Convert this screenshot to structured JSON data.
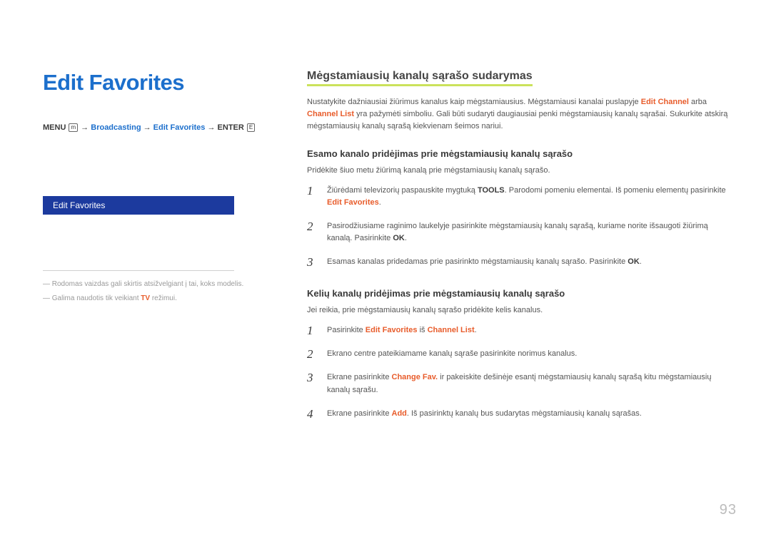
{
  "left": {
    "title": "Edit Favorites",
    "breadcrumb": {
      "menu": "MENU",
      "menu_icon": "m",
      "seg1": "Broadcasting",
      "seg2": "Edit Favorites",
      "enter": "ENTER",
      "enter_icon": "E"
    },
    "menu_item": "Edit Favorites",
    "footnote1_pre": " ― Rodomas vaizdas gali skirtis atsižvelgiant į tai, koks modelis.",
    "footnote2_pre": " ― Galima naudotis tik veikiant ",
    "footnote2_hl": "TV",
    "footnote2_post": " režimui."
  },
  "right": {
    "section_title": "Mėgstamiausių kanalų sąrašo sudarymas",
    "intro_pre": "Nustatykite dažniausiai žiūrimus kanalus kaip mėgstamiausius. Mėgstamiausi kanalai puslapyje ",
    "intro_hl1": "Edit Channel",
    "intro_mid": " arba ",
    "intro_hl2": "Channel List",
    "intro_post": " yra pažymėti simboliu. Gali būti sudaryti daugiausiai penki mėgstamiausių kanalų sąrašai. Sukurkite atskirą mėgstamiausių kanalų sąrašą kiekvienam šeimos nariui.",
    "sub1": {
      "heading": "Esamo kanalo pridėjimas prie mėgstamiausių kanalų sąrašo",
      "intro": "Pridėkite šiuo metu žiūrimą kanalą prie mėgstamiausių kanalų sąrašo.",
      "s1_pre": "Žiūrėdami televizorių paspauskite mygtuką ",
      "s1_strong": "TOOLS",
      "s1_mid": ". Parodomi pomeniu elementai. Iš pomeniu elementų pasirinkite ",
      "s1_hl": "Edit Favorites",
      "s1_post": ".",
      "s2_pre": "Pasirodžiusiame raginimo laukelyje pasirinkite mėgstamiausių kanalų sąrašą, kuriame norite išsaugoti žiūrimą kanalą. Pasirinkite ",
      "s2_strong": "OK",
      "s2_post": ".",
      "s3_pre": "Esamas kanalas pridedamas prie pasirinkto mėgstamiausių kanalų sąrašo. Pasirinkite ",
      "s3_strong": "OK",
      "s3_post": "."
    },
    "sub2": {
      "heading": "Kelių kanalų pridėjimas prie mėgstamiausių kanalų sąrašo",
      "intro": "Jei reikia, prie mėgstamiausių kanalų sąrašo pridėkite kelis kanalus.",
      "s1_pre": "Pasirinkite ",
      "s1_hl1": "Edit Favorites",
      "s1_mid": " iš ",
      "s1_hl2": "Channel List",
      "s1_post": ".",
      "s2": "Ekrano centre pateikiamame kanalų sąraše pasirinkite norimus kanalus.",
      "s3_pre": "Ekrane pasirinkite ",
      "s3_hl": "Change Fav.",
      "s3_post": " ir pakeiskite dešinėje esantį mėgstamiausių kanalų sąrašą kitu mėgstamiausių kanalų sąrašu.",
      "s4_pre": "Ekrane pasirinkite ",
      "s4_hl": "Add",
      "s4_post": ". Iš pasirinktų kanalų bus sudarytas mėgstamiausių kanalų sąrašas."
    },
    "page_number": "93"
  }
}
